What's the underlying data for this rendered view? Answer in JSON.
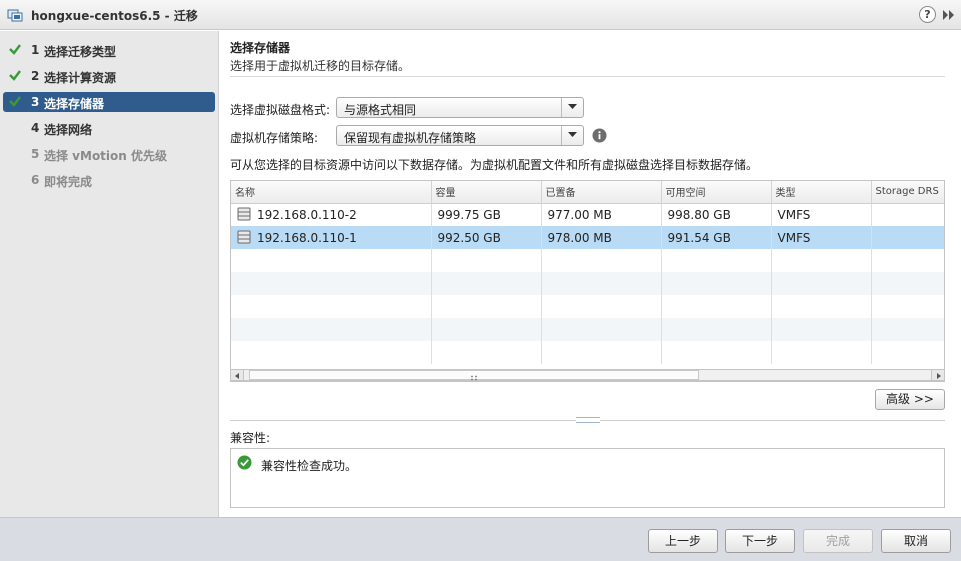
{
  "window": {
    "title": "hongxue-centos6.5 - 迁移",
    "help_label": "?"
  },
  "steps": [
    {
      "num": "1",
      "label": "选择迁移类型",
      "state": "done"
    },
    {
      "num": "2",
      "label": "选择计算资源",
      "state": "done"
    },
    {
      "num": "3",
      "label": "选择存储器",
      "state": "active"
    },
    {
      "num": "4",
      "label": "选择网络",
      "state": "next"
    },
    {
      "num": "5",
      "label": "选择 vMotion 优先级",
      "state": "disabled"
    },
    {
      "num": "6",
      "label": "即将完成",
      "state": "disabled"
    }
  ],
  "main": {
    "title": "选择存储器",
    "subtitle": "选择用于虚拟机迁移的目标存储。",
    "disk_format": {
      "label": "选择虚拟磁盘格式:",
      "value": "与源格式相同"
    },
    "storage_policy": {
      "label": "虚拟机存储策略:",
      "value": "保留现有虚拟机存储策略"
    },
    "description": "可从您选择的目标资源中访问以下数据存储。为虚拟机配置文件和所有虚拟磁盘选择目标数据存储。",
    "table": {
      "columns": [
        "名称",
        "容量",
        "已置备",
        "可用空间",
        "类型",
        "Storage DRS"
      ],
      "rows": [
        {
          "name": "192.168.0.110-2",
          "capacity": "999.75 GB",
          "provisioned": "977.00 MB",
          "free": "998.80 GB",
          "type": "VMFS",
          "drs": "",
          "selected": false
        },
        {
          "name": "192.168.0.110-1",
          "capacity": "992.50 GB",
          "provisioned": "978.00 MB",
          "free": "991.54 GB",
          "type": "VMFS",
          "drs": "",
          "selected": true
        }
      ]
    },
    "advanced_label": "高级 >>",
    "compat_label": "兼容性:",
    "compat_message": "兼容性检查成功。"
  },
  "footer": {
    "back_label": "上一步",
    "next_label": "下一步",
    "finish_label": "完成",
    "cancel_label": "取消"
  },
  "colors": {
    "active_step": "#2f5c8d",
    "selected_row": "#b9dbf6",
    "check_green": "#3a9a3a"
  }
}
